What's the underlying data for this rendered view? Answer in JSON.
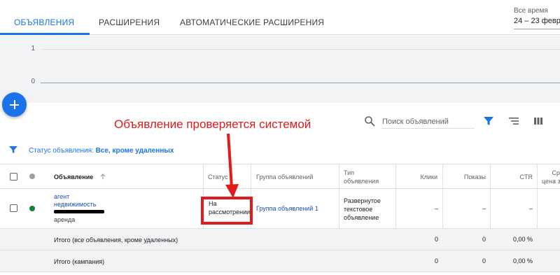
{
  "tabs": [
    {
      "label": "ОБЪЯВЛЕНИЯ",
      "active": true
    },
    {
      "label": "РАСШИРЕНИЯ",
      "active": false
    },
    {
      "label": "АВТОМАТИЧЕСКИЕ РАСШИРЕНИЯ",
      "active": false
    }
  ],
  "date_range": {
    "label": "Все время",
    "value": "24 – 23 февр."
  },
  "chart": {
    "y_ticks": [
      "1",
      "0"
    ]
  },
  "annotation": {
    "text": "Объявление проверяется системой",
    "color": "#e01b1b"
  },
  "toolbar": {
    "search_placeholder": "Поиск объявлений",
    "icons": [
      "search-icon",
      "filter-icon",
      "segment-icon",
      "columns-icon"
    ]
  },
  "filter": {
    "prefix": "Статус объявления:",
    "value": "Все, кроме удаленных"
  },
  "table": {
    "headers": {
      "ad": "Объявление",
      "status": "Статус",
      "ad_group": "Группа объявлений",
      "type_line1": "Тип",
      "type_line2": "объявления",
      "clicks": "Клики",
      "impressions": "Показы",
      "ctr": "CTR",
      "cpc_line1": "Ср",
      "cpc_line2": "цена з"
    },
    "row": {
      "ad_line1": "агент",
      "ad_line2": "недвижимость",
      "ad_line3": "аренда",
      "status_line1": "На",
      "status_line2": "рассмотрении",
      "ad_group": "Группа объявлений 1",
      "type_line1": "Развернутое",
      "type_line2": "текстовое",
      "type_line3": "объявление",
      "clicks": "–",
      "impressions": "–",
      "ctr": "–",
      "status_dot_color": "#188038"
    },
    "totals": [
      {
        "label": "Итого (все объявления, кроме удаленных)",
        "clicks": "0",
        "impressions": "0",
        "ctr": "0,00 %"
      },
      {
        "label": "Итого (кампания)",
        "clicks": "0",
        "impressions": "0",
        "ctr": "0,00 %"
      }
    ]
  },
  "colors": {
    "accent": "#1a73e8",
    "highlight": "#e01b1b"
  }
}
